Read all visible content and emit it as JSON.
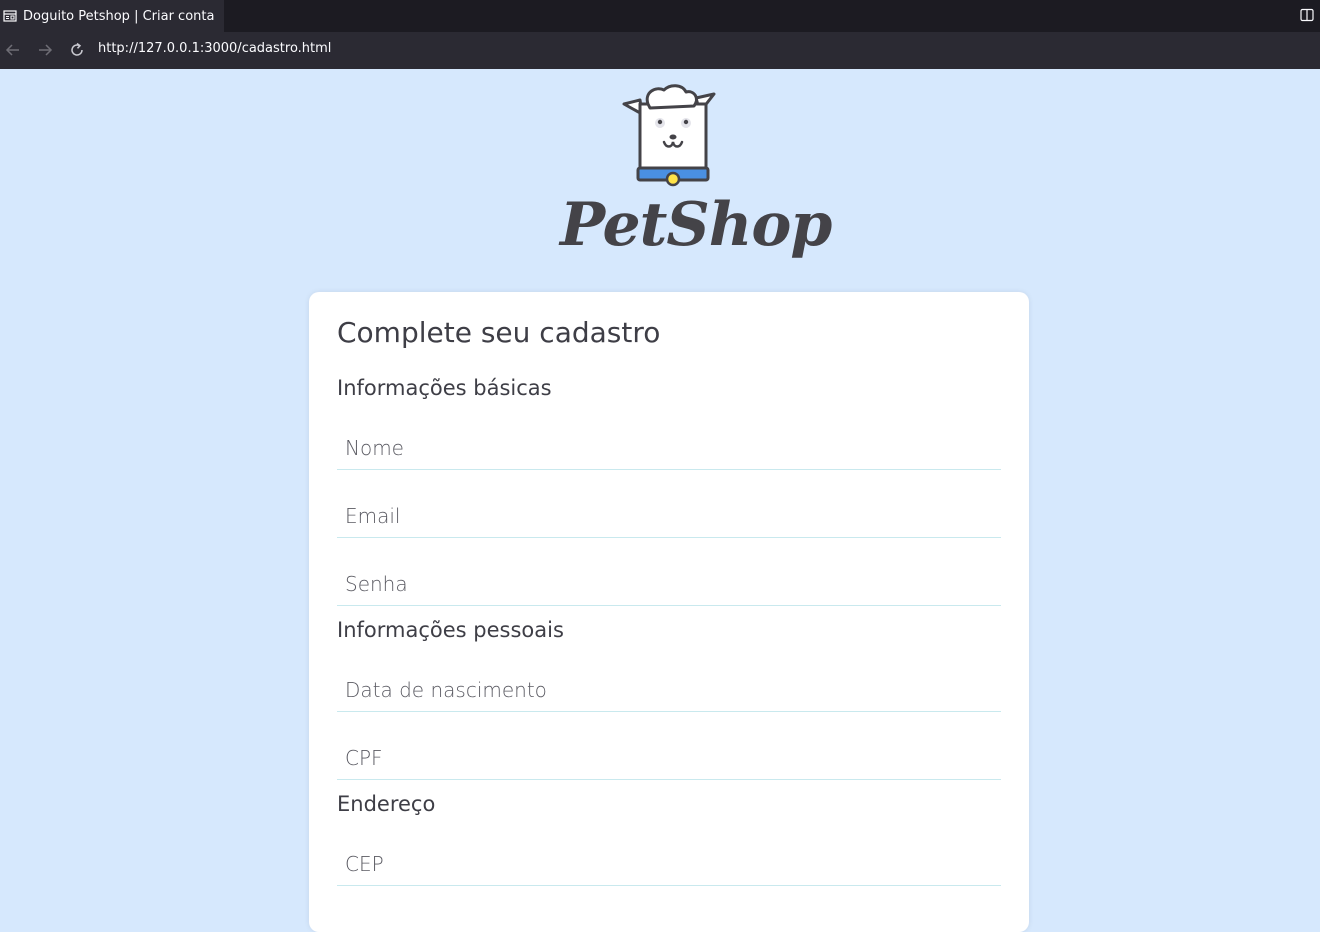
{
  "browser": {
    "tab_title": "Doguito Petshop | Criar conta",
    "url": "http://127.0.0.1:3000/cadastro.html"
  },
  "logo": {
    "text": "PetShop",
    "icon": "dog-chef-icon"
  },
  "form": {
    "title": "Complete seu cadastro",
    "sections": {
      "basic": "Informações básicas",
      "personal": "Informações pessoais",
      "address": "Endereço"
    },
    "fields": {
      "nome": "Nome",
      "email": "Email",
      "senha": "Senha",
      "nascimento": "Data de nascimento",
      "cpf": "CPF",
      "cep": "CEP"
    }
  },
  "colors": {
    "page_background": "#d6e8fd",
    "card_background": "#ffffff",
    "text": "#3e3e46",
    "field_underline": "#c9e9ee",
    "collar": "#4a90e2",
    "tag": "#ffe347"
  }
}
